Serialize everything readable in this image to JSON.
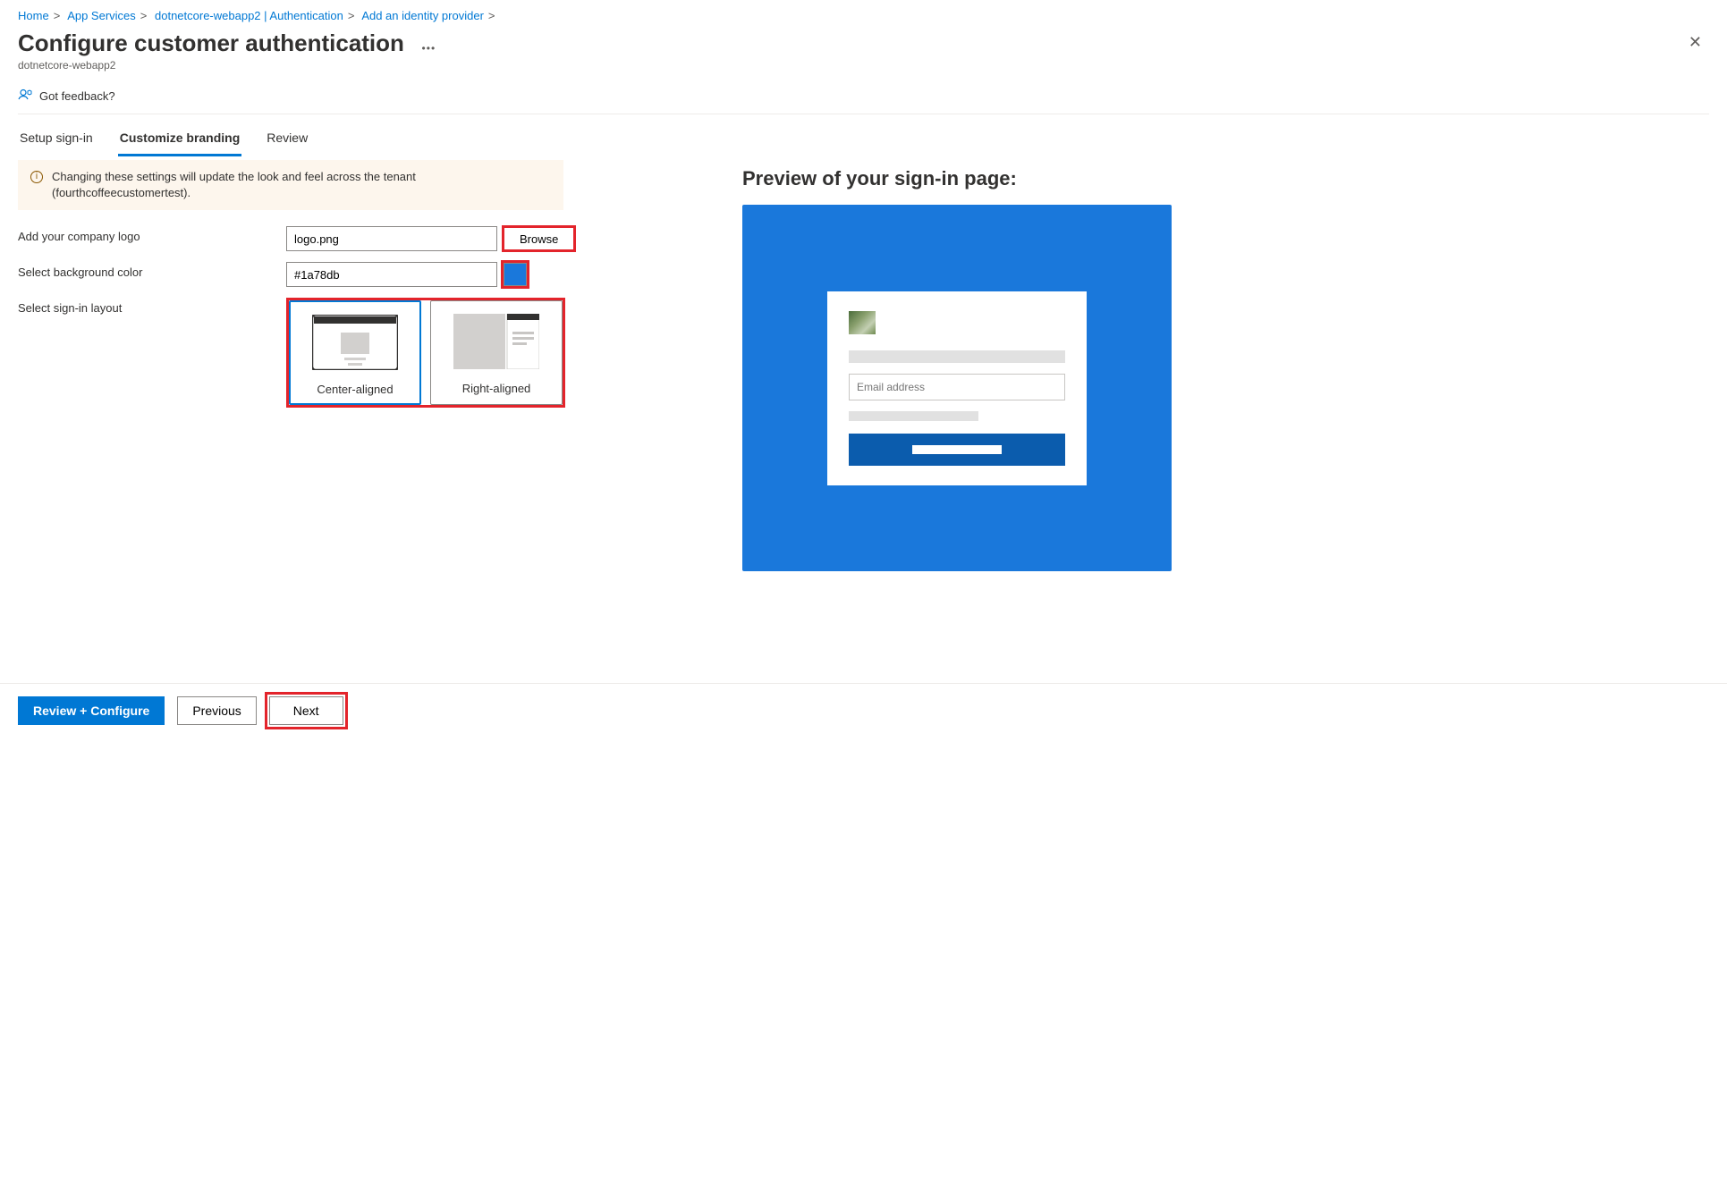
{
  "breadcrumb": {
    "items": [
      "Home",
      "App Services",
      "dotnetcore-webapp2 | Authentication",
      "Add an identity provider"
    ]
  },
  "header": {
    "title": "Configure customer authentication",
    "subtitle": "dotnetcore-webapp2"
  },
  "feedback": {
    "label": "Got feedback?"
  },
  "tabs": {
    "items": [
      {
        "label": "Setup sign-in",
        "active": false
      },
      {
        "label": "Customize branding",
        "active": true
      },
      {
        "label": "Review",
        "active": false
      }
    ]
  },
  "banner": {
    "text": "Changing these settings will update the look and feel across the tenant (fourthcoffeecustomertest)."
  },
  "form": {
    "logo": {
      "label": "Add your company logo",
      "value": "logo.png",
      "browse": "Browse"
    },
    "bgcolor": {
      "label": "Select background color",
      "value": "#1a78db"
    },
    "layout": {
      "label": "Select sign-in layout",
      "options": [
        {
          "caption": "Center-aligned",
          "selected": true
        },
        {
          "caption": "Right-aligned",
          "selected": false
        }
      ]
    }
  },
  "preview": {
    "title": "Preview of your sign-in page:",
    "email_placeholder": "Email address"
  },
  "footer": {
    "review": "Review + Configure",
    "previous": "Previous",
    "next": "Next"
  },
  "colors": {
    "accent": "#0078d4",
    "highlight": "#e3242b",
    "preview_bg": "#1a78db"
  }
}
